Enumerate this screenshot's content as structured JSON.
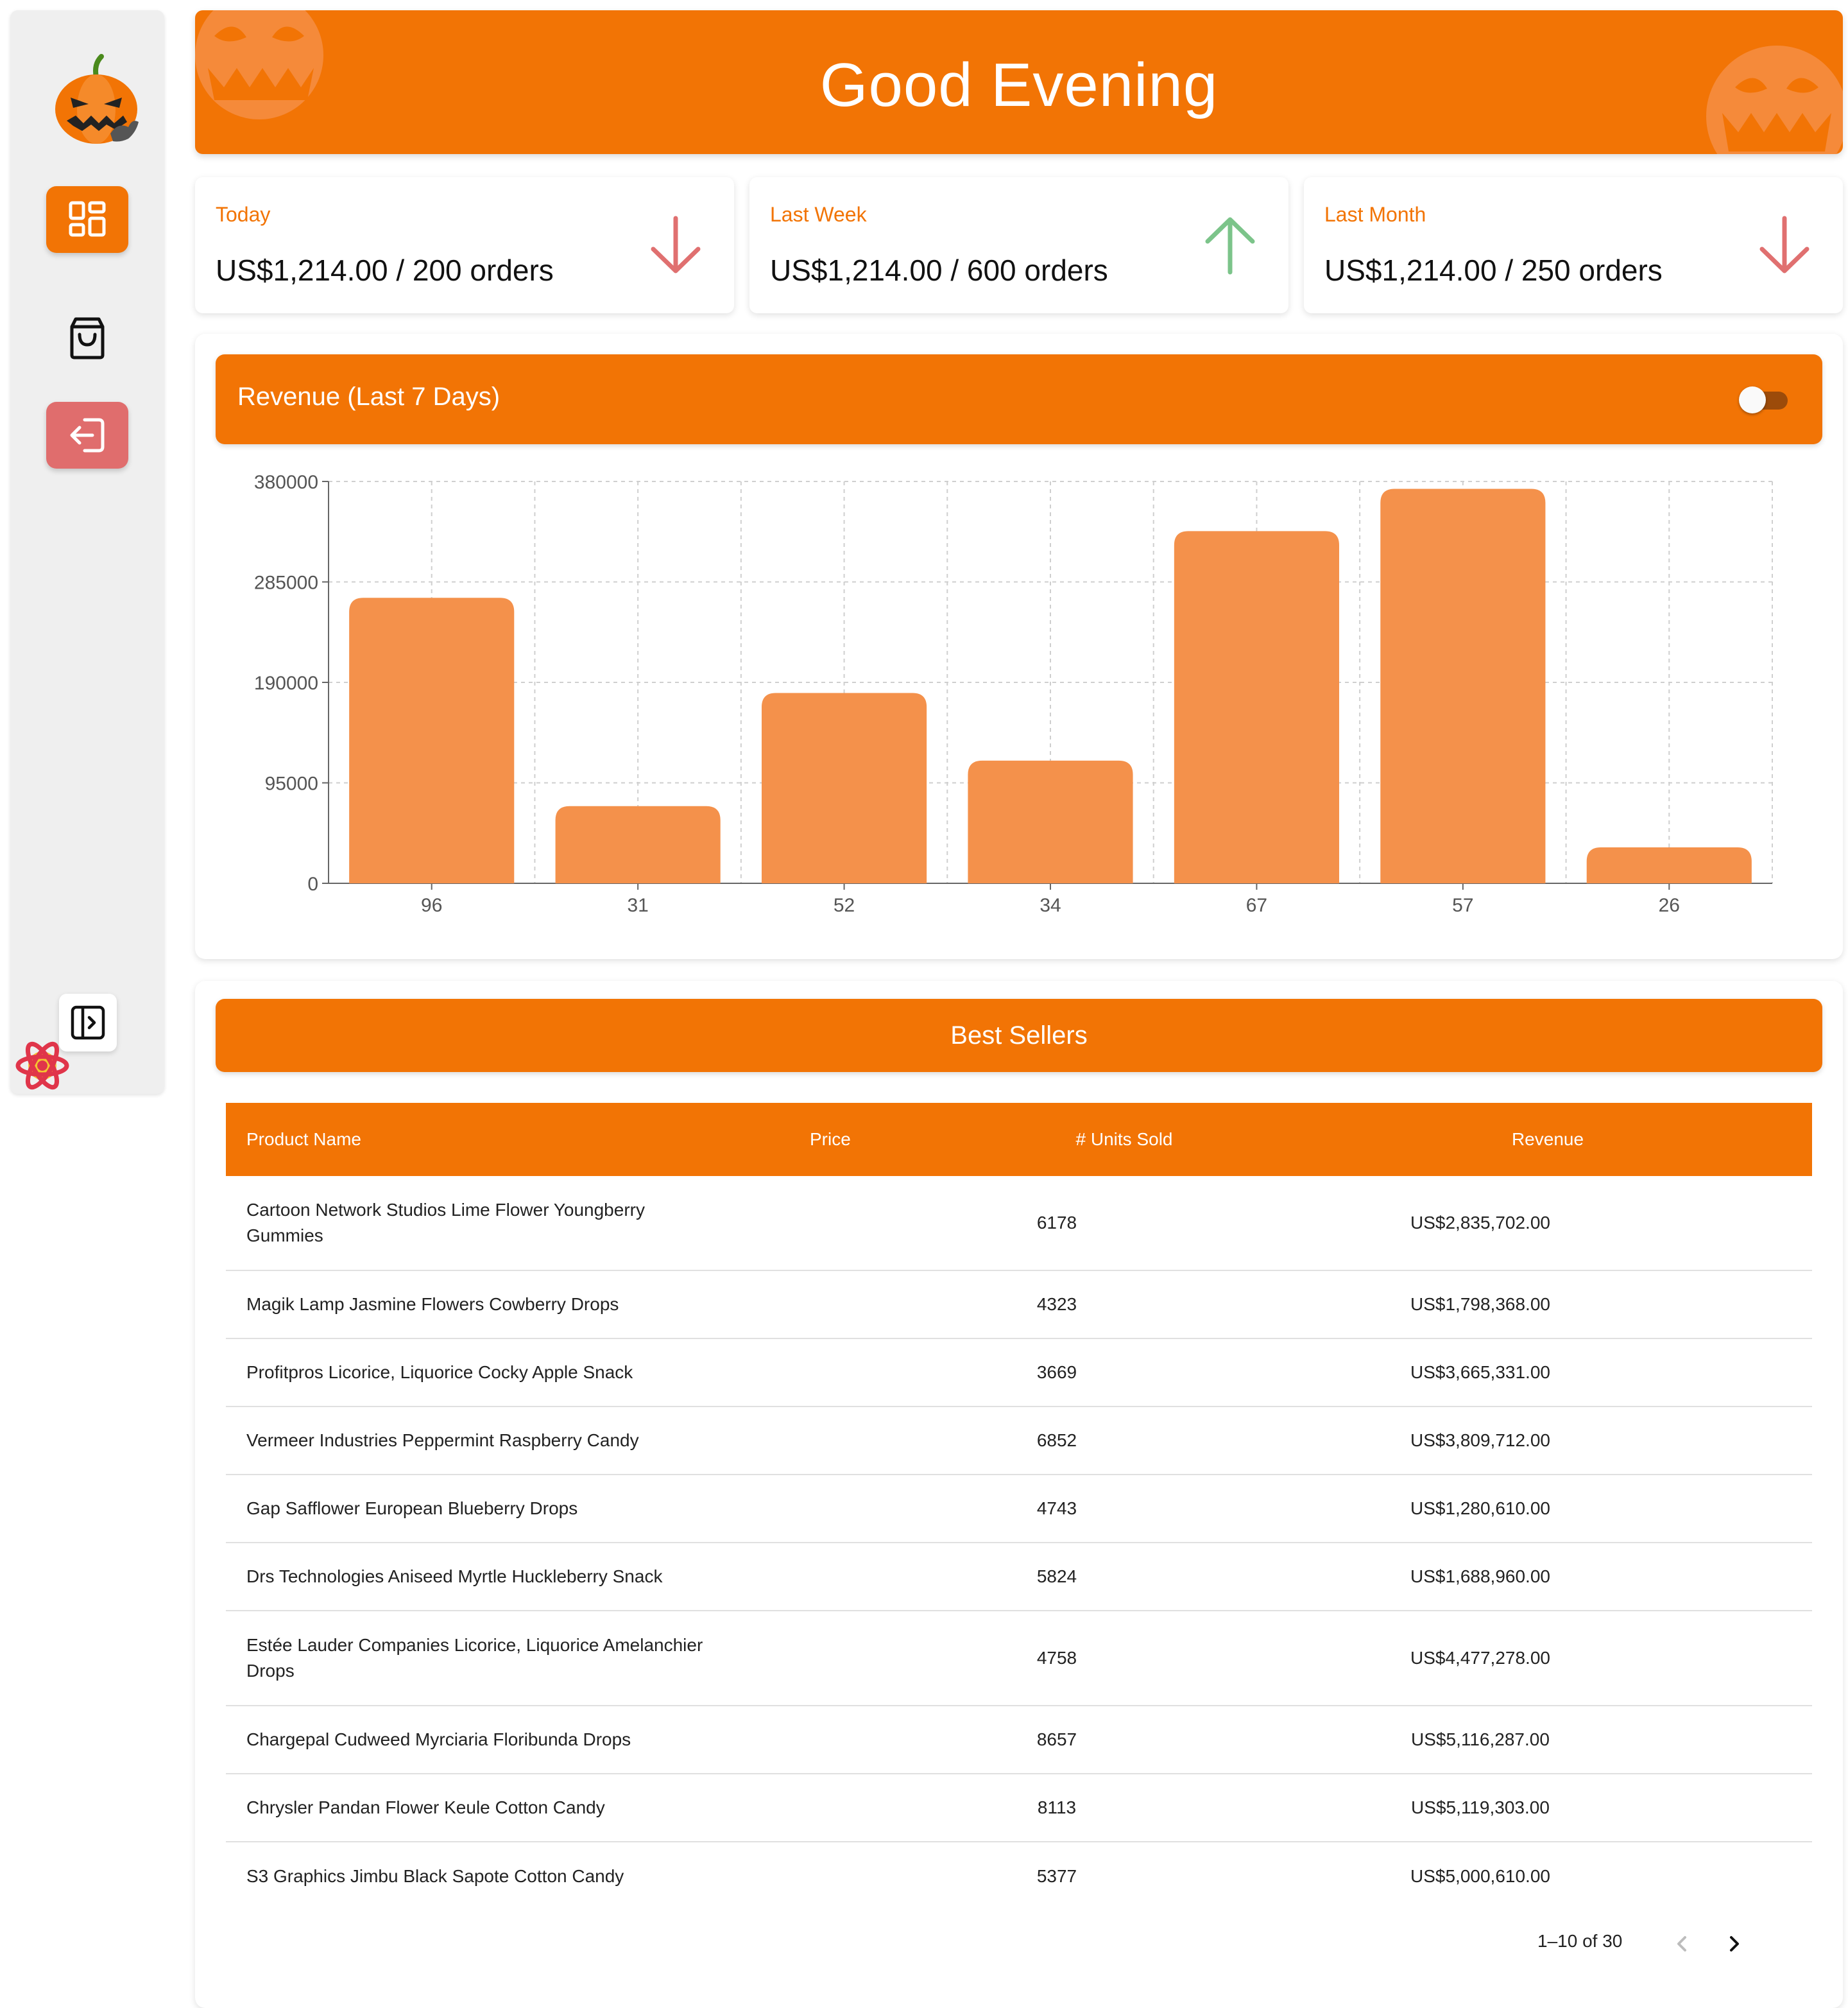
{
  "sidebar": {
    "items": [
      {
        "name": "dashboard",
        "icon": "dashboard-icon"
      },
      {
        "name": "orders",
        "icon": "shopping-bag-icon"
      },
      {
        "name": "logout",
        "icon": "logout-icon"
      }
    ],
    "collapse_icon": "sidebar-expand-icon",
    "badge_icon": "react-query-devtools-icon"
  },
  "header": {
    "title": "Good Evening"
  },
  "stats": [
    {
      "label": "Today",
      "value": "US$1,214.00 / 200 orders",
      "trend": "down"
    },
    {
      "label": "Last Week",
      "value": "US$1,214.00 / 600 orders",
      "trend": "up"
    },
    {
      "label": "Last Month",
      "value": "US$1,214.00 / 250 orders",
      "trend": "down"
    }
  ],
  "revenue": {
    "title": "Revenue (Last 7 Days)",
    "toggle_on": false
  },
  "chart_data": {
    "type": "bar",
    "categories": [
      "96",
      "31",
      "52",
      "34",
      "67",
      "57",
      "26"
    ],
    "values": [
      270000,
      73000,
      180000,
      116000,
      333000,
      373000,
      34000
    ],
    "yticks": [
      0,
      95000,
      190000,
      285000,
      380000
    ],
    "ylim": [
      0,
      380000
    ],
    "grid": true,
    "bar_color": "#f4914b"
  },
  "best_sellers": {
    "title": "Best Sellers",
    "columns": [
      "Product Name",
      "Price",
      "# Units Sold",
      "Revenue"
    ],
    "rows": [
      {
        "name": "Cartoon Network Studios Lime Flower Youngberry Gummies",
        "price": "",
        "units": "6178",
        "revenue": "US$2,835,702.00"
      },
      {
        "name": "Magik Lamp Jasmine Flowers Cowberry Drops",
        "price": "",
        "units": "4323",
        "revenue": "US$1,798,368.00"
      },
      {
        "name": "Profitpros Licorice, Liquorice Cocky Apple Snack",
        "price": "",
        "units": "3669",
        "revenue": "US$3,665,331.00"
      },
      {
        "name": "Vermeer Industries Peppermint Raspberry Candy",
        "price": "",
        "units": "6852",
        "revenue": "US$3,809,712.00"
      },
      {
        "name": "Gap Safflower European Blueberry Drops",
        "price": "",
        "units": "4743",
        "revenue": "US$1,280,610.00"
      },
      {
        "name": "Drs Technologies Aniseed Myrtle Huckleberry Snack",
        "price": "",
        "units": "5824",
        "revenue": "US$1,688,960.00"
      },
      {
        "name": "Estée Lauder Companies Licorice, Liquorice Amelanchier Drops",
        "price": "",
        "units": "4758",
        "revenue": "US$4,477,278.00"
      },
      {
        "name": "Chargepal Cudweed Myrciaria Floribunda Drops",
        "price": "",
        "units": "8657",
        "revenue": "US$5,116,287.00"
      },
      {
        "name": "Chrysler Pandan Flower Keule Cotton Candy",
        "price": "",
        "units": "8113",
        "revenue": "US$5,119,303.00"
      },
      {
        "name": "S3 Graphics Jimbu Black Sapote Cotton Candy",
        "price": "",
        "units": "5377",
        "revenue": "US$5,000,610.00"
      }
    ],
    "pagination": "1–10 of 30"
  },
  "colors": {
    "accent": "#f27405",
    "logout": "#e06d6d",
    "trend_down": "#e07070",
    "trend_up": "#7cc48a"
  }
}
